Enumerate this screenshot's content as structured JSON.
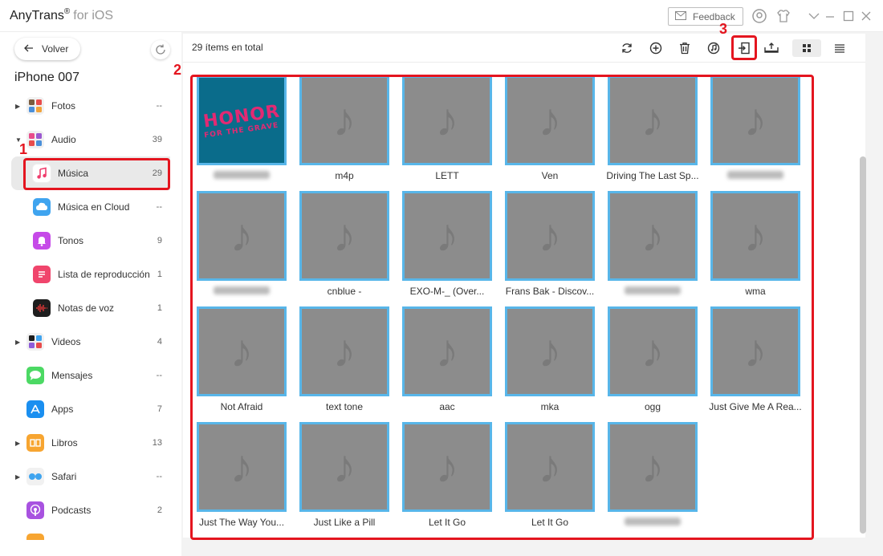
{
  "titlebar": {
    "app_name": "AnyTrans",
    "reg": "®",
    "platform": "for iOS",
    "feedback_label": "Feedback"
  },
  "sidebar": {
    "back_label": "Volver",
    "device_name": "iPhone 007",
    "items": [
      {
        "label": "Fotos",
        "count": "--",
        "icon": "photos-icon"
      },
      {
        "label": "Audio",
        "count": "39",
        "icon": "audio-icon"
      },
      {
        "label": "Música",
        "count": "29",
        "icon": "music-icon"
      },
      {
        "label": "Música en Cloud",
        "count": "--",
        "icon": "cloud-music-icon"
      },
      {
        "label": "Tonos",
        "count": "9",
        "icon": "ringtones-icon"
      },
      {
        "label": "Lista de reproducción",
        "count": "1",
        "icon": "playlist-icon"
      },
      {
        "label": "Notas de voz",
        "count": "1",
        "icon": "voice-memos-icon"
      },
      {
        "label": "Videos",
        "count": "4",
        "icon": "videos-icon"
      },
      {
        "label": "Mensajes",
        "count": "--",
        "icon": "messages-icon"
      },
      {
        "label": "Apps",
        "count": "7",
        "icon": "apps-icon"
      },
      {
        "label": "Libros",
        "count": "13",
        "icon": "books-icon"
      },
      {
        "label": "Safari",
        "count": "--",
        "icon": "safari-icon"
      },
      {
        "label": "Podcasts",
        "count": "2",
        "icon": "podcasts-icon"
      }
    ]
  },
  "toolbar": {
    "total": "29 ítems en total"
  },
  "tiles": [
    {
      "label": "",
      "blurred": true,
      "cover": true
    },
    {
      "label": "m4p"
    },
    {
      "label": "LETT"
    },
    {
      "label": "Ven"
    },
    {
      "label": "Driving The Last Sp..."
    },
    {
      "label": "",
      "blurred": true
    },
    {
      "label": "",
      "blurred": true
    },
    {
      "label": "cnblue - "
    },
    {
      "label": "EXO-M-_ (Over..."
    },
    {
      "label": "Frans Bak - Discov..."
    },
    {
      "label": "",
      "blurred": true
    },
    {
      "label": "wma"
    },
    {
      "label": "Not Afraid"
    },
    {
      "label": "text tone"
    },
    {
      "label": "aac"
    },
    {
      "label": "mka"
    },
    {
      "label": "ogg"
    },
    {
      "label": "Just Give Me A Rea..."
    },
    {
      "label": "Just The Way You..."
    },
    {
      "label": "Just Like a Pill"
    },
    {
      "label": "Let It Go"
    },
    {
      "label": "Let It Go"
    },
    {
      "label": "",
      "blurred": true
    }
  ],
  "cover_art": {
    "line1": "HONOR",
    "line2": "FOR THE GRAVE"
  },
  "annotations": [
    "1",
    "2",
    "3"
  ],
  "colors": {
    "accent_border": "#58b6e9",
    "annotation_red": "#e4151f"
  }
}
